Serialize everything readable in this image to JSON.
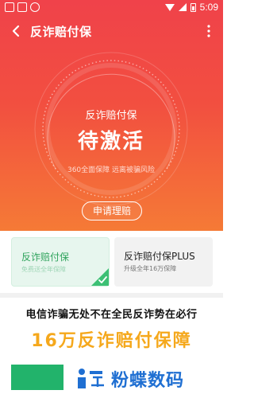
{
  "status_bar": {
    "time": "5:09",
    "icons": [
      "square-icon",
      "image-icon",
      "sync-icon",
      "wifi-icon",
      "signal-icon",
      "battery-icon"
    ]
  },
  "header": {
    "title": "反诈赔付保",
    "back_icon": "chevron-left-icon",
    "more_icon": "more-vertical-icon"
  },
  "hero": {
    "product_name": "反诈赔付保",
    "status": "待激活",
    "description": "360全面保障 远离被骗风险",
    "apply_button": "申请理赔"
  },
  "plans": [
    {
      "title": "反诈赔付保",
      "subtitle": "免费送全年保障",
      "selected": true
    },
    {
      "title": "反诈赔付保PLUS",
      "subtitle": "升级全年16万保障",
      "selected": false
    }
  ],
  "promo": {
    "line1": "电信诈骗无处不在全民反诈势在必行",
    "line2": "16万反诈赔付保障"
  },
  "watermark": {
    "text": "粉蝶数码"
  },
  "colors": {
    "hero_top": "#f0424a",
    "hero_bottom": "#f57a36",
    "selected_green": "#2fa35c",
    "promo_gold": "#f5a81c",
    "watermark_blue": "#1f6fd2"
  }
}
